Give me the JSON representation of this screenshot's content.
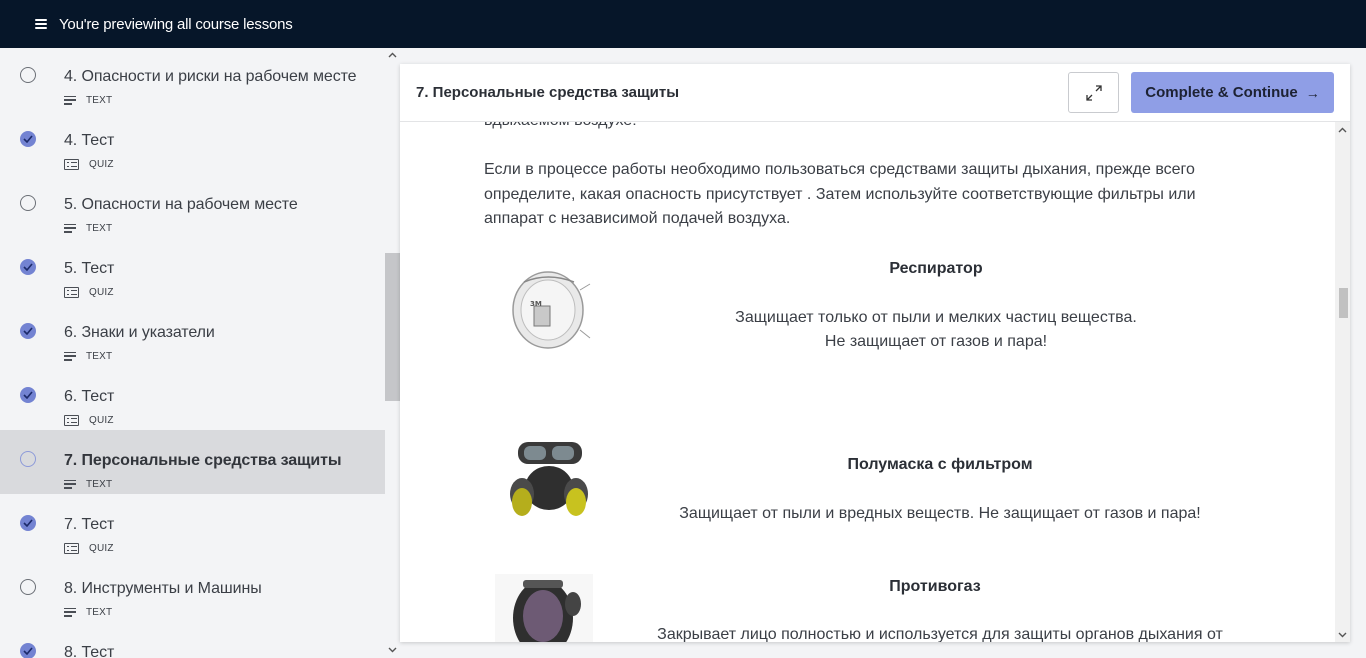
{
  "topbar": {
    "title": "You're previewing all course lessons"
  },
  "sidebar": {
    "lessons": [
      {
        "title": "4. Опасности и риски на рабочем месте",
        "type": "TEXT",
        "status": "open"
      },
      {
        "title": "4. Тест",
        "type": "QUIZ",
        "status": "done"
      },
      {
        "title": "5. Опасности на рабочем месте",
        "type": "TEXT",
        "status": "open"
      },
      {
        "title": "5. Тест",
        "type": "QUIZ",
        "status": "done"
      },
      {
        "title": "6. Знаки и указатели",
        "type": "TEXT",
        "status": "done"
      },
      {
        "title": "6. Тест",
        "type": "QUIZ",
        "status": "done"
      },
      {
        "title": "7. Персональные средства защиты",
        "type": "TEXT",
        "status": "open",
        "active": true
      },
      {
        "title": "7. Тест",
        "type": "QUIZ",
        "status": "done"
      },
      {
        "title": "8. Инструменты и Машины",
        "type": "TEXT",
        "status": "open"
      },
      {
        "title": "8. Тест",
        "type": "QUIZ",
        "status": "done"
      }
    ]
  },
  "panel": {
    "title": "7. Персональные средства защиты",
    "complete_label": "Complete & Continue",
    "cut_line": "вдыхаемом воздухе!",
    "paragraph": "Если в процессе работы необходимо пользоваться средствами защиты дыхания, прежде всего определите, какая опасность присутствует . Затем используйте соответствующие фильтры или аппарат с независимой подачей воздуха.",
    "items": [
      {
        "title": "Респиратор",
        "desc1": "Защищает только от пыли и мелких частиц вещества.",
        "desc2": "Не защищает от газов и пара!"
      },
      {
        "title": "Полумаска с фильтром",
        "desc1": "Защищает от пыли и вредных веществ. Не защищает от газов и пара!"
      },
      {
        "title": "Противогаз",
        "desc1": "Закрывает лицо полностью и используется для защиты органов дыхания от"
      }
    ]
  },
  "colors": {
    "topbar": "#061629",
    "accent": "#8f9ee6",
    "done": "#7383d2"
  }
}
